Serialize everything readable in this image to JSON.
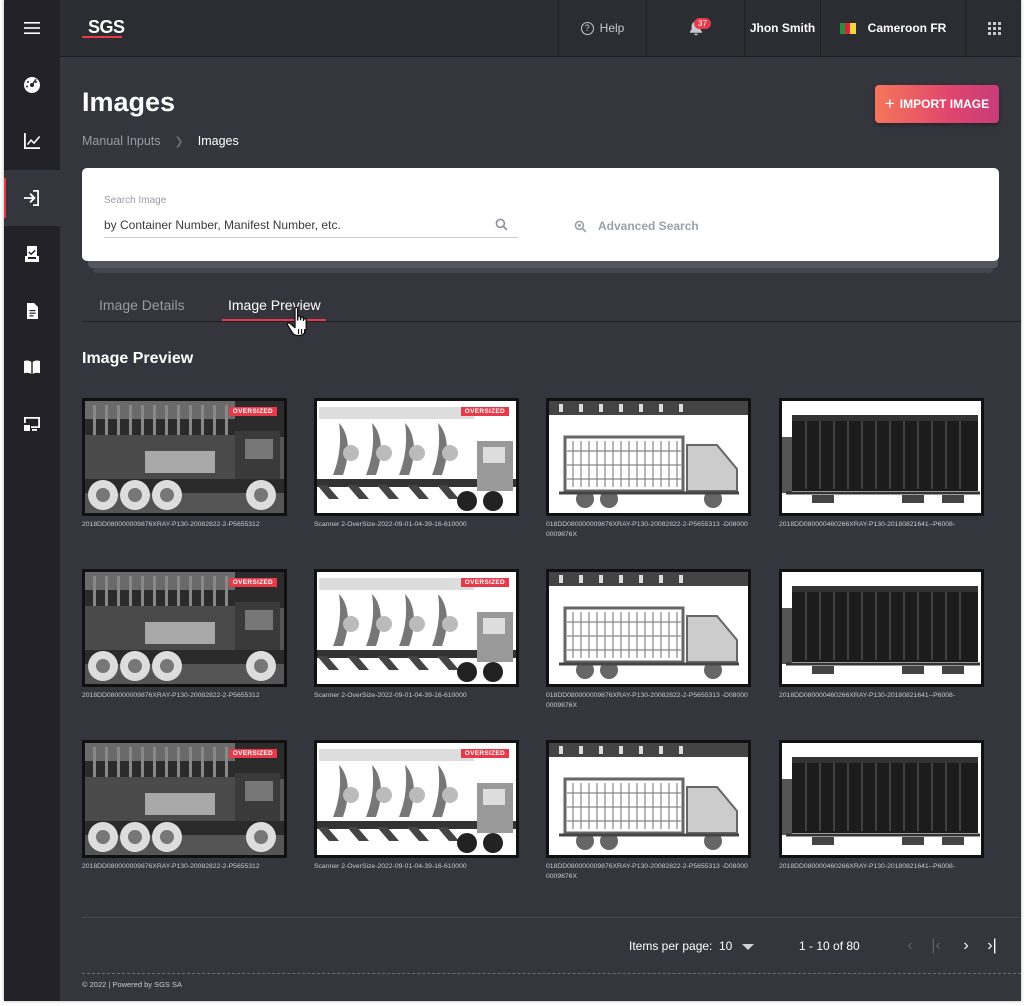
{
  "topbar": {
    "logo": "SGS",
    "help_label": "Help",
    "notification_count": "37",
    "user_name": "Jhon Smith",
    "locale_label": "Cameroon FR"
  },
  "sidebar": {
    "items": [
      {
        "icon": "menu-icon"
      },
      {
        "icon": "dashboard-icon"
      },
      {
        "icon": "chart-icon"
      },
      {
        "icon": "manual-inputs-icon",
        "active": true
      },
      {
        "icon": "clipboard-check-icon"
      },
      {
        "icon": "document-icon"
      },
      {
        "icon": "book-icon"
      },
      {
        "icon": "monitor-icon"
      }
    ]
  },
  "page": {
    "title": "Images",
    "breadcrumb": [
      "Manual Inputs",
      "Images"
    ],
    "import_label": "IMPORT IMAGE"
  },
  "search": {
    "label": "Search Image",
    "placeholder": "by Container Number, Manifest Number, etc.",
    "advanced_label": "Advanced Search"
  },
  "tabs": {
    "details": "Image Details",
    "preview": "Image Preview"
  },
  "section_title": "Image Preview",
  "oversized_label": "OVERSIZED",
  "images": [
    {
      "caption": "2018DD080000009876XRAY-P130-20082822-2-P5655312",
      "oversized": true
    },
    {
      "caption": "Scanner 2-OverSize-2022-09-01-04-39-16-610000",
      "oversized": true
    },
    {
      "caption": "018DD080000009876XRAY-P130-20082822-2-P5655313 -D080000009876X",
      "oversized": false
    },
    {
      "caption": "2018DD080000460266XRAY-P130-20180821641--P6008-",
      "oversized": false
    },
    {
      "caption": "2018DD080000009876XRAY-P130-20082822-2-P5655312",
      "oversized": true
    },
    {
      "caption": "Scanner 2-OverSize-2022-09-01-04-39-16-610000",
      "oversized": true
    },
    {
      "caption": "018DD080000009876XRAY-P130-20082822-2-P5655313 -D080000009876X",
      "oversized": false
    },
    {
      "caption": "2018DD080000460266XRAY-P130-20180821641--P6008-",
      "oversized": false
    },
    {
      "caption": "2018DD080000009876XRAY-P130-20082822-2-P5655312",
      "oversized": true
    },
    {
      "caption": "Scanner 2-OverSize-2022-09-01-04-39-16-610000",
      "oversized": true
    },
    {
      "caption": "018DD080000009876XRAY-P130-20082822-2-P5655313 -D080000009876X",
      "oversized": false
    },
    {
      "caption": "2018DD080000460266XRAY-P130-20180821641--P6008-",
      "oversized": false
    }
  ],
  "pagination": {
    "items_per_page_label": "Items per page:",
    "items_per_page": "10",
    "range": "1 - 10 of 80"
  },
  "footer": "© 2022  |  Powered by SGS SA",
  "colors": {
    "accent": "#e8394a",
    "background": "#35353d",
    "sidebar": "#222228"
  }
}
